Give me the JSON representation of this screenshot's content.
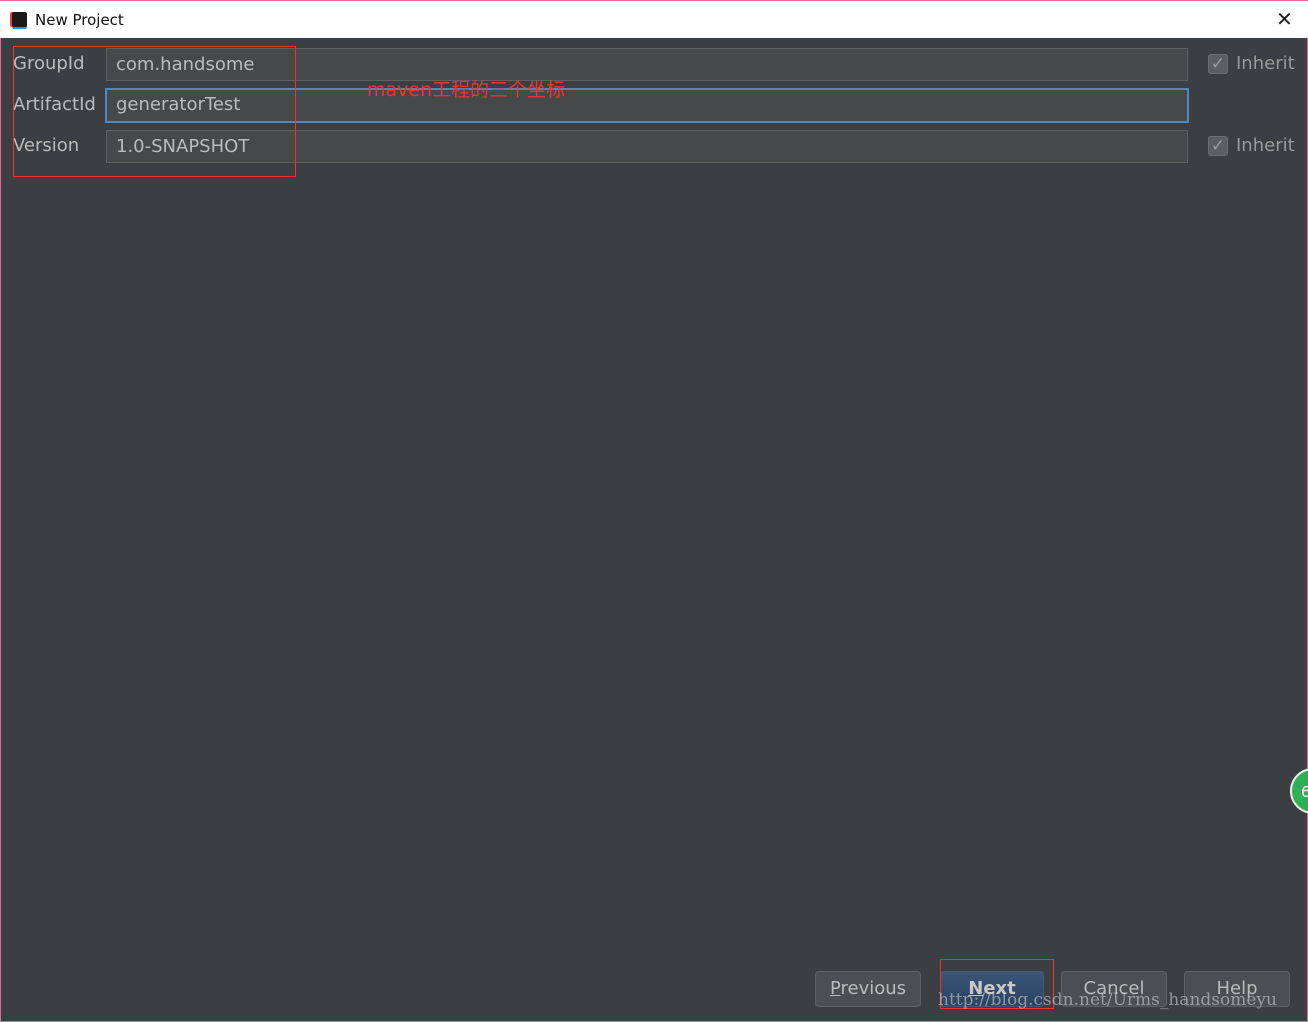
{
  "window": {
    "title": "New Project"
  },
  "form": {
    "group_id": {
      "label": "GroupId",
      "value": "com.handsome",
      "inherit_label": "Inherit",
      "inherit_checked": true
    },
    "artifact_id": {
      "label": "ArtifactId",
      "value": "generatorTest"
    },
    "version": {
      "label": "Version",
      "value": "1.0-SNAPSHOT",
      "inherit_label": "Inherit",
      "inherit_checked": true
    }
  },
  "annotation": "maven工程的三个坐标",
  "buttons": {
    "previous_mn": "P",
    "previous_rest": "revious",
    "next_mn": "N",
    "next_rest": "ext",
    "cancel": "Cancel",
    "help": "Help"
  },
  "watermark": "http://blog.csdn.net/Urms_handsomeyu",
  "badge": "6",
  "colors": {
    "background": "#3c3f41",
    "focus": "#4a88c7",
    "annotation": "#ee3333",
    "primary_button": "#2c4261"
  }
}
